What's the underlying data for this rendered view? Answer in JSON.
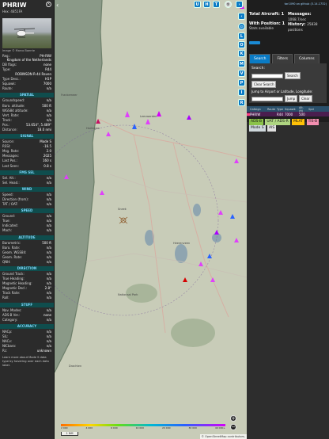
{
  "infobox": {
    "callsign": "PHRIW",
    "hex_label": "Hex:",
    "hex": "4851FA",
    "photo_credit": "Image © Marco Boerrie",
    "reg_label": "Reg.:",
    "reg": "PH-RIW",
    "country": "Kingdom of the Netherlands",
    "dbflags_label": "DB flags:",
    "dbflags": "none",
    "type_label": "Type:",
    "type": "R44",
    "model": "ROBINSON R-44 Raven",
    "typedesc_label": "Type Desc.:",
    "typedesc": "H1P",
    "squawk_label": "Squawk:",
    "squawk": "7000",
    "route_label": "Route:",
    "route": "n/a",
    "sections": {
      "spatial": "SPATIAL",
      "signal": "SIGNAL",
      "fms": "FMS SEL",
      "wind": "WIND",
      "speed": "SPEED",
      "altitude": "ALTITUDE",
      "direction": "DIRECTION",
      "stuff": "STUFF",
      "accuracy": "ACCURACY"
    },
    "spatial": [
      {
        "k": "Groundspeed:",
        "v": "n/a"
      },
      {
        "k": "Baro. altitude:",
        "v": "500 ft"
      },
      {
        "k": "WGS84 altitude:",
        "v": "n/a"
      },
      {
        "k": "Vert. Rate:",
        "v": "n/a"
      },
      {
        "k": "Track:",
        "v": "n/a"
      },
      {
        "k": "Pos.:",
        "v": "53.654°, 5.489°"
      },
      {
        "k": "Distance:",
        "v": "18.0 nmi"
      }
    ],
    "signal": [
      {
        "k": "Source:",
        "v": "Mode S"
      },
      {
        "k": "RSSI:",
        "v": "-16.5"
      },
      {
        "k": "Msg. Rate:",
        "v": "2.0"
      },
      {
        "k": "Messages:",
        "v": "2025"
      },
      {
        "k": "Last Pos.:",
        "v": "160 s"
      },
      {
        "k": "Last Seen:",
        "v": "0.8 s"
      }
    ],
    "fms": [
      {
        "k": "Sel. Alt.:",
        "v": "n/a"
      },
      {
        "k": "Sel. Head.:",
        "v": "n/a"
      }
    ],
    "wind": [
      {
        "k": "Speed:",
        "v": "n/a"
      },
      {
        "k": "Direction (from):",
        "v": "n/a"
      },
      {
        "k": "TAT / OAT:",
        "v": "n/a"
      }
    ],
    "speed": [
      {
        "k": "Ground:",
        "v": "n/a"
      },
      {
        "k": "True:",
        "v": "n/a"
      },
      {
        "k": "Indicated:",
        "v": "n/a"
      },
      {
        "k": "Mach:",
        "v": "n/a"
      }
    ],
    "altitude": [
      {
        "k": "Barometric:",
        "v": "500 ft"
      },
      {
        "k": "Baro. Rate:",
        "v": "n/a"
      },
      {
        "k": "Geom. WGS84:",
        "v": "n/a"
      },
      {
        "k": "Geom. Rate:",
        "v": "n/a"
      },
      {
        "k": "QNH:",
        "v": "n/a"
      }
    ],
    "direction": [
      {
        "k": "Ground Track:",
        "v": "n/a"
      },
      {
        "k": "True Heading:",
        "v": "n/a"
      },
      {
        "k": "Magnetic Heading:",
        "v": "n/a"
      },
      {
        "k": "Magnetic Decl.:",
        "v": "2.8°"
      },
      {
        "k": "Track Rate:",
        "v": "n/a"
      },
      {
        "k": "Roll:",
        "v": "n/a"
      }
    ],
    "stuff": [
      {
        "k": "Nav. Modes:",
        "v": "n/a"
      },
      {
        "k": "ADS-B Ver.:",
        "v": "none"
      },
      {
        "k": "Category:",
        "v": "n/a"
      }
    ],
    "accuracy": [
      {
        "k": "NACp:",
        "v": "n/a"
      },
      {
        "k": "SIL:",
        "v": "n/a"
      },
      {
        "k": "NACv:",
        "v": "n/a"
      },
      {
        "k": "NICbaro:",
        "v": "n/a"
      },
      {
        "k": "Rc:",
        "v": "unknown"
      }
    ],
    "footer": "Learn more about Mode S data type by hovering over each data label."
  },
  "map": {
    "buttons": [
      "U",
      "H",
      "T"
    ],
    "side_buttons": [
      "L",
      "O",
      "K",
      "M",
      "P",
      "I",
      "R"
    ],
    "zoom_in": "+",
    "zoom_out": "−",
    "scale": "1 NM",
    "attribution": "© OpenStreetMap contributors.",
    "legend_ticks": [
      "2 000",
      "4 000",
      "6 000",
      "10 000",
      "20 000",
      "30 000",
      "40 000+"
    ],
    "place_labels": [
      "Frankemeer",
      "Harlingen",
      "Leeuwarden",
      "Sneek",
      "Heerenveen",
      "Nationaal Park",
      "Drachten"
    ]
  },
  "panel": {
    "link": "tar1090 on github (3.14.1732)",
    "total_label": "Total Aircraft:",
    "total": "1",
    "position_label": "With Position:",
    "position": "1",
    "stats_label": "Stats available",
    "messages_label": "Messages:",
    "messages": "1068.7/sec",
    "history_label": "History:",
    "history": "25838 positions",
    "tabs": [
      "Search",
      "Filters",
      "Columns"
    ],
    "search_label": "Search:",
    "search_btn": "Search",
    "clear_btn": "Clear Search",
    "jump_label": "Jump to Airport or Latitude, Longitude:",
    "jump_btn": "Jump",
    "clear2_btn": "Clear",
    "columns": [
      "Callsign",
      "Route",
      "Type",
      "Squawk",
      "Alt. (ft)",
      "Spd"
    ],
    "row": {
      "callsign": "PHRIW",
      "route": "",
      "type": "R44",
      "squawk": "7000",
      "alt": "500",
      "spd": ""
    },
    "sources": [
      "ADS-B",
      "UAT / ADS-R",
      "MLAT",
      "TIS-B",
      "Mode S",
      "AIS"
    ],
    "colors": {
      "adsb": "#8bc34a",
      "uat": "#aed581",
      "mlat": "#ffc107",
      "tisb": "#f48fb1",
      "modes": "#cfd8dc",
      "ais": "#e0e0e0"
    }
  }
}
